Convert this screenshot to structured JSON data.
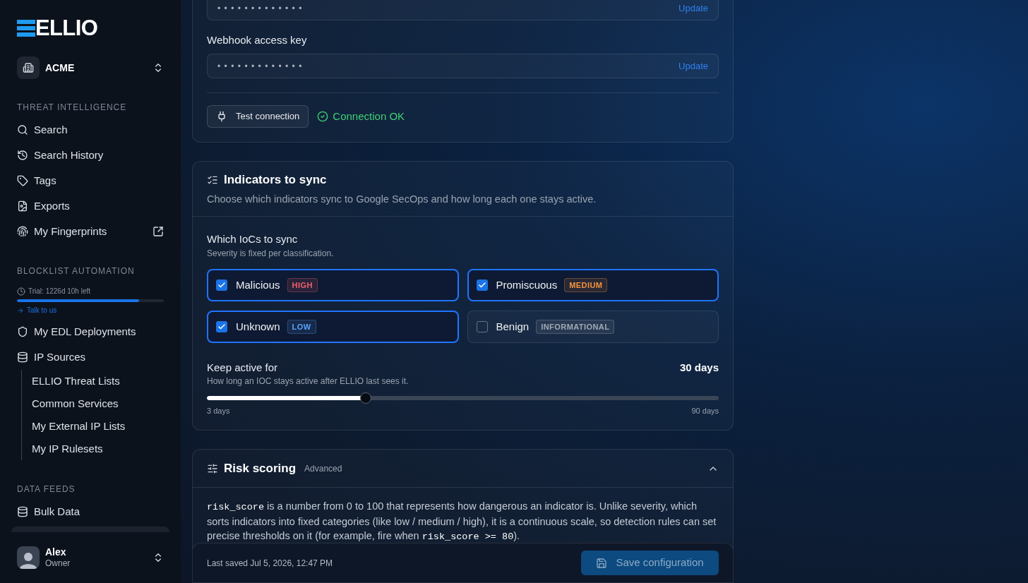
{
  "sidebar": {
    "logo": {
      "text": "ELLIO"
    },
    "organization": {
      "name": "ACME"
    },
    "sections": [
      {
        "heading": "THREAT INTELLIGENCE",
        "items": [
          {
            "label": "Search",
            "external": false
          },
          {
            "label": "Search History",
            "external": false
          },
          {
            "label": "Tags",
            "external": false
          },
          {
            "label": "Exports",
            "external": false
          },
          {
            "label": "My Fingerprints",
            "external": true
          }
        ]
      },
      {
        "heading": "BLOCKLIST AUTOMATION",
        "trial": {
          "text": "Trial: 1226d 10h left",
          "level": 0.83,
          "link": "Talk to us"
        },
        "items": [
          {
            "label": "My EDL Deployments",
            "external": false
          },
          {
            "label": "IP Sources",
            "external": false,
            "expanded": true,
            "children": [
              {
                "label": "ELLIO Threat Lists"
              },
              {
                "label": "Common Services"
              },
              {
                "label": "My External IP Lists"
              },
              {
                "label": "My IP Rulesets"
              }
            ]
          }
        ]
      },
      {
        "heading": "DATA FEEDS",
        "items": [
          {
            "label": "Bulk Data",
            "external": false
          }
        ]
      }
    ],
    "user": {
      "name": "Alex",
      "role": "Owner"
    }
  },
  "connection": {
    "fields": [
      {
        "value": "•••••••••••••",
        "action": "Update"
      },
      {
        "label": "Webhook access key",
        "value": "•••••••••••••",
        "action": "Update"
      }
    ],
    "test_button": "Test connection",
    "status": {
      "kind": "ok",
      "text": "Connection OK"
    }
  },
  "indicators": {
    "title": "Indicators to sync",
    "description": "Choose which indicators sync to Google SecOps and how long each one stays active.",
    "group_label": "Which IoCs to sync",
    "group_hint": "Severity is fixed per classification.",
    "options": [
      {
        "label": "Malicious",
        "badge": "HIGH",
        "color": "#f0616d",
        "checked": true
      },
      {
        "label": "Promiscuous",
        "badge": "MEDIUM",
        "color": "#f5943f",
        "checked": true
      },
      {
        "label": "Unknown",
        "badge": "LOW",
        "color": "#5aa2ff",
        "checked": true
      },
      {
        "label": "Benign",
        "badge": "INFORMATIONAL",
        "color": "#a3aab5",
        "checked": false
      }
    ],
    "keep_active": {
      "label": "Keep active for",
      "value": "30 days",
      "hint": "How long an IOC stays active after ELLIO last sees it.",
      "level": 0.31,
      "min_label": "3 days",
      "max_label": "90 days"
    }
  },
  "risk_scoring": {
    "title": "Risk scoring",
    "tag": "Advanced",
    "expanded": true,
    "paragraph": [
      {
        "kind": "code",
        "text": "risk_score"
      },
      {
        "kind": "text",
        "text": " is a number from 0 to 100 that represents how dangerous an indicator is. Unlike severity, which sorts indicators into fixed categories (like low / medium / high), it is a continuous scale, so detection rules can set precise thresholds on it (for example, fire when "
      },
      {
        "kind": "code",
        "text": "risk_score >= 80"
      },
      {
        "kind": "text",
        "text": ")."
      }
    ]
  },
  "footer": {
    "last_saved": "Last saved Jul 5, 2026, 12:47 PM",
    "save_button": {
      "label": "Save configuration",
      "disabled": true
    }
  }
}
